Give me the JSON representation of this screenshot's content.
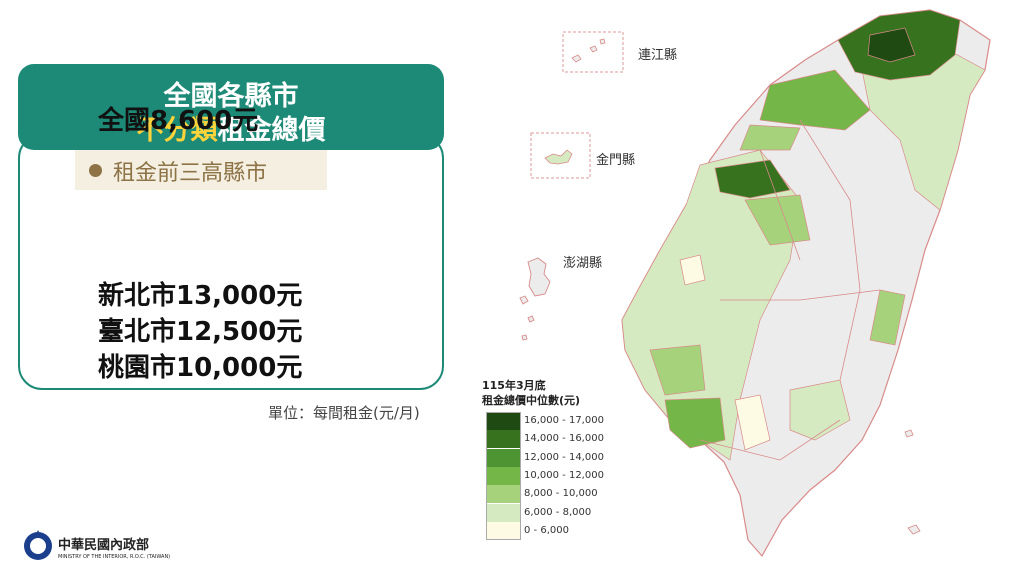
{
  "card": {
    "title_line1": "全國各縣市",
    "title_highlight": "不分類",
    "title_rest": "租金總價",
    "national": "全國8,600元",
    "top3_label": "租金前三高縣市",
    "top3": [
      "新北市13,000元",
      "臺北市12,500元",
      "桃園市10,000元"
    ],
    "unit": "單位：每間租金(元/月)"
  },
  "logo": {
    "name_zh": "中華民國內政部",
    "name_en": "MINISTRY OF THE INTERIOR, R.O.C. (TAIWAN)"
  },
  "map": {
    "islands": [
      "連江縣",
      "金門縣",
      "澎湖縣"
    ],
    "legend_title": [
      "115年3月底",
      "租金總價中位數(元)"
    ],
    "legend": [
      {
        "range": "16,000 - 17,000",
        "color": "#1f4a12"
      },
      {
        "range": "14,000 - 16,000",
        "color": "#37721f"
      },
      {
        "range": "12,000 - 14,000",
        "color": "#4e9432"
      },
      {
        "range": "10,000 - 12,000",
        "color": "#74b648"
      },
      {
        "range": "8,000 - 10,000",
        "color": "#a6d27c"
      },
      {
        "range": "6,000 - 8,000",
        "color": "#d6eac1"
      },
      {
        "range": "0 - 6,000",
        "color": "#fdfbe3"
      }
    ]
  },
  "colors": {
    "header": "#1d8a78",
    "highlight": "#ffd43b",
    "bullet": "#8d7346",
    "no_data": "#ececec",
    "boundary": "#d98a8a"
  }
}
